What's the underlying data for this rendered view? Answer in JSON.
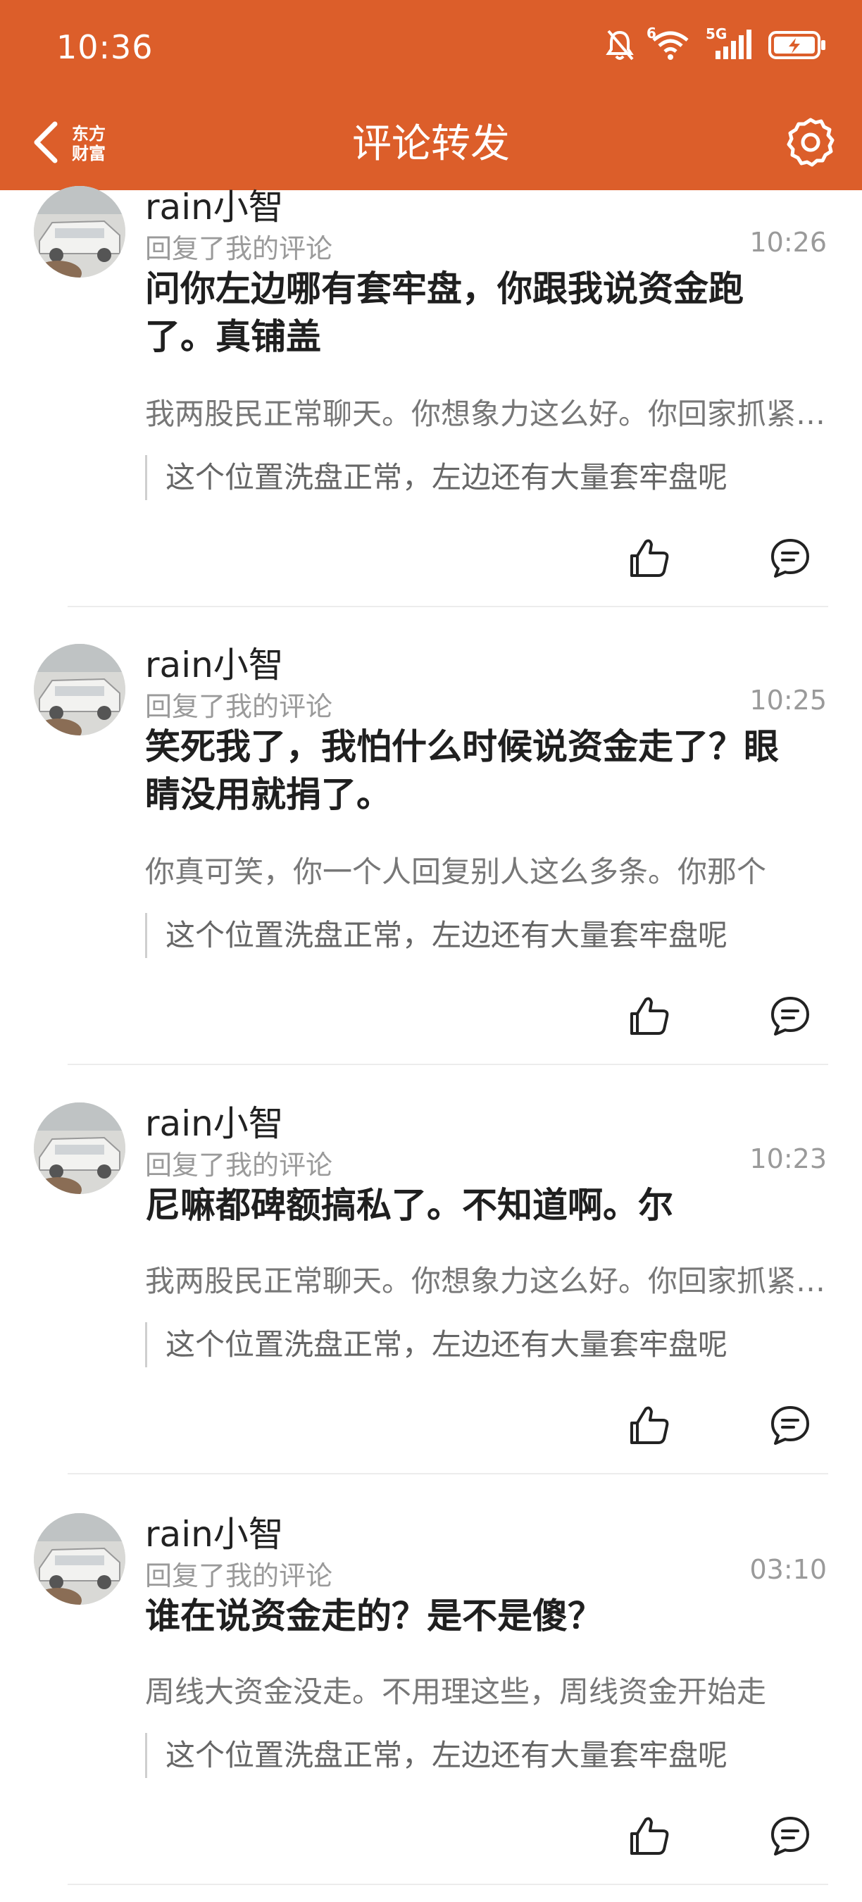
{
  "status_bar": {
    "time": "10:36",
    "network_label": "5G",
    "wifi_label": "6",
    "icons": [
      "mute-bell-icon",
      "wifi-icon",
      "signal-icon",
      "battery-charging-icon"
    ]
  },
  "header": {
    "title": "评论转发",
    "logo_line1": "东方",
    "logo_line2": "财富",
    "back_icon": "chevron-left-icon",
    "settings_icon": "gear-icon",
    "accent_color": "#dc5e2a"
  },
  "comments": [
    {
      "username": "rain小智",
      "action": "回复了我的评论",
      "time": "10:26",
      "reply": "问你左边哪有套牢盘，你跟我说资金跑了。真铺盖",
      "my_comment": "我两股民正常聊天。你想象力这么好。你回家抓紧时间",
      "quote": "这个位置洗盘正常，左边还有大量套牢盘呢"
    },
    {
      "username": "rain小智",
      "action": "回复了我的评论",
      "time": "10:25",
      "reply": "笑死我了，我怕什么时候说资金走了？眼睛没用就捐了。",
      "my_comment": "你真可笑，你一个人回复别人这么多条。你那个",
      "quote": "这个位置洗盘正常，左边还有大量套牢盘呢"
    },
    {
      "username": "rain小智",
      "action": "回复了我的评论",
      "time": "10:23",
      "reply": "尼嘛都碑额搞私了。不知道啊。尔",
      "my_comment": "我两股民正常聊天。你想象力这么好。你回家抓紧时间",
      "quote": "这个位置洗盘正常，左边还有大量套牢盘呢"
    },
    {
      "username": "rain小智",
      "action": "回复了我的评论",
      "time": "03:10",
      "reply": "谁在说资金走的？是不是傻？",
      "my_comment": "周线大资金没走。不用理这些，周线资金开始走",
      "quote": "这个位置洗盘正常，左边还有大量套牢盘呢"
    }
  ]
}
